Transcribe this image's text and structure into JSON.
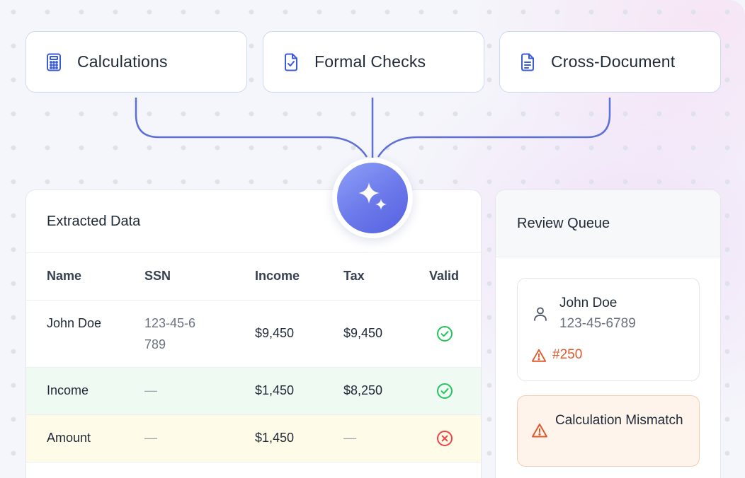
{
  "checks": [
    {
      "label": "Calculations",
      "icon": "calculator-icon"
    },
    {
      "label": "Formal Checks",
      "icon": "document-check-icon"
    },
    {
      "label": "Cross-Document",
      "icon": "document-text-icon"
    }
  ],
  "hub": {
    "icon": "sparkles-icon"
  },
  "extracted": {
    "title": "Extracted Data",
    "columns": [
      "Name",
      "SSN",
      "Income",
      "Tax",
      "Valid"
    ],
    "rows": [
      {
        "name": "John Doe",
        "ssn": "123-45-6789",
        "income": "$9,450",
        "tax": "$9,450",
        "valid": "check-circle-icon"
      },
      {
        "name": "Income",
        "ssn": "—",
        "income": "$1,450",
        "tax": "$8,250",
        "valid": "check-circle-icon"
      },
      {
        "name": "Amount",
        "ssn": "—",
        "income": "$1,450",
        "tax": "—",
        "valid": "x-circle-icon"
      }
    ]
  },
  "queue": {
    "title": "Review Queue",
    "item": {
      "name": "John Doe",
      "ssn": "123-45-6789",
      "flag": "#250",
      "icon": "user-icon",
      "flag_icon": "warning-icon"
    },
    "alert": {
      "text": "Calculation Mismatch",
      "icon": "warning-icon"
    }
  },
  "colors": {
    "accent": "#3b5bdb",
    "connector": "#5d6fd8",
    "success": "#22c55e",
    "error": "#ef4444",
    "warning": "#e0572a"
  }
}
